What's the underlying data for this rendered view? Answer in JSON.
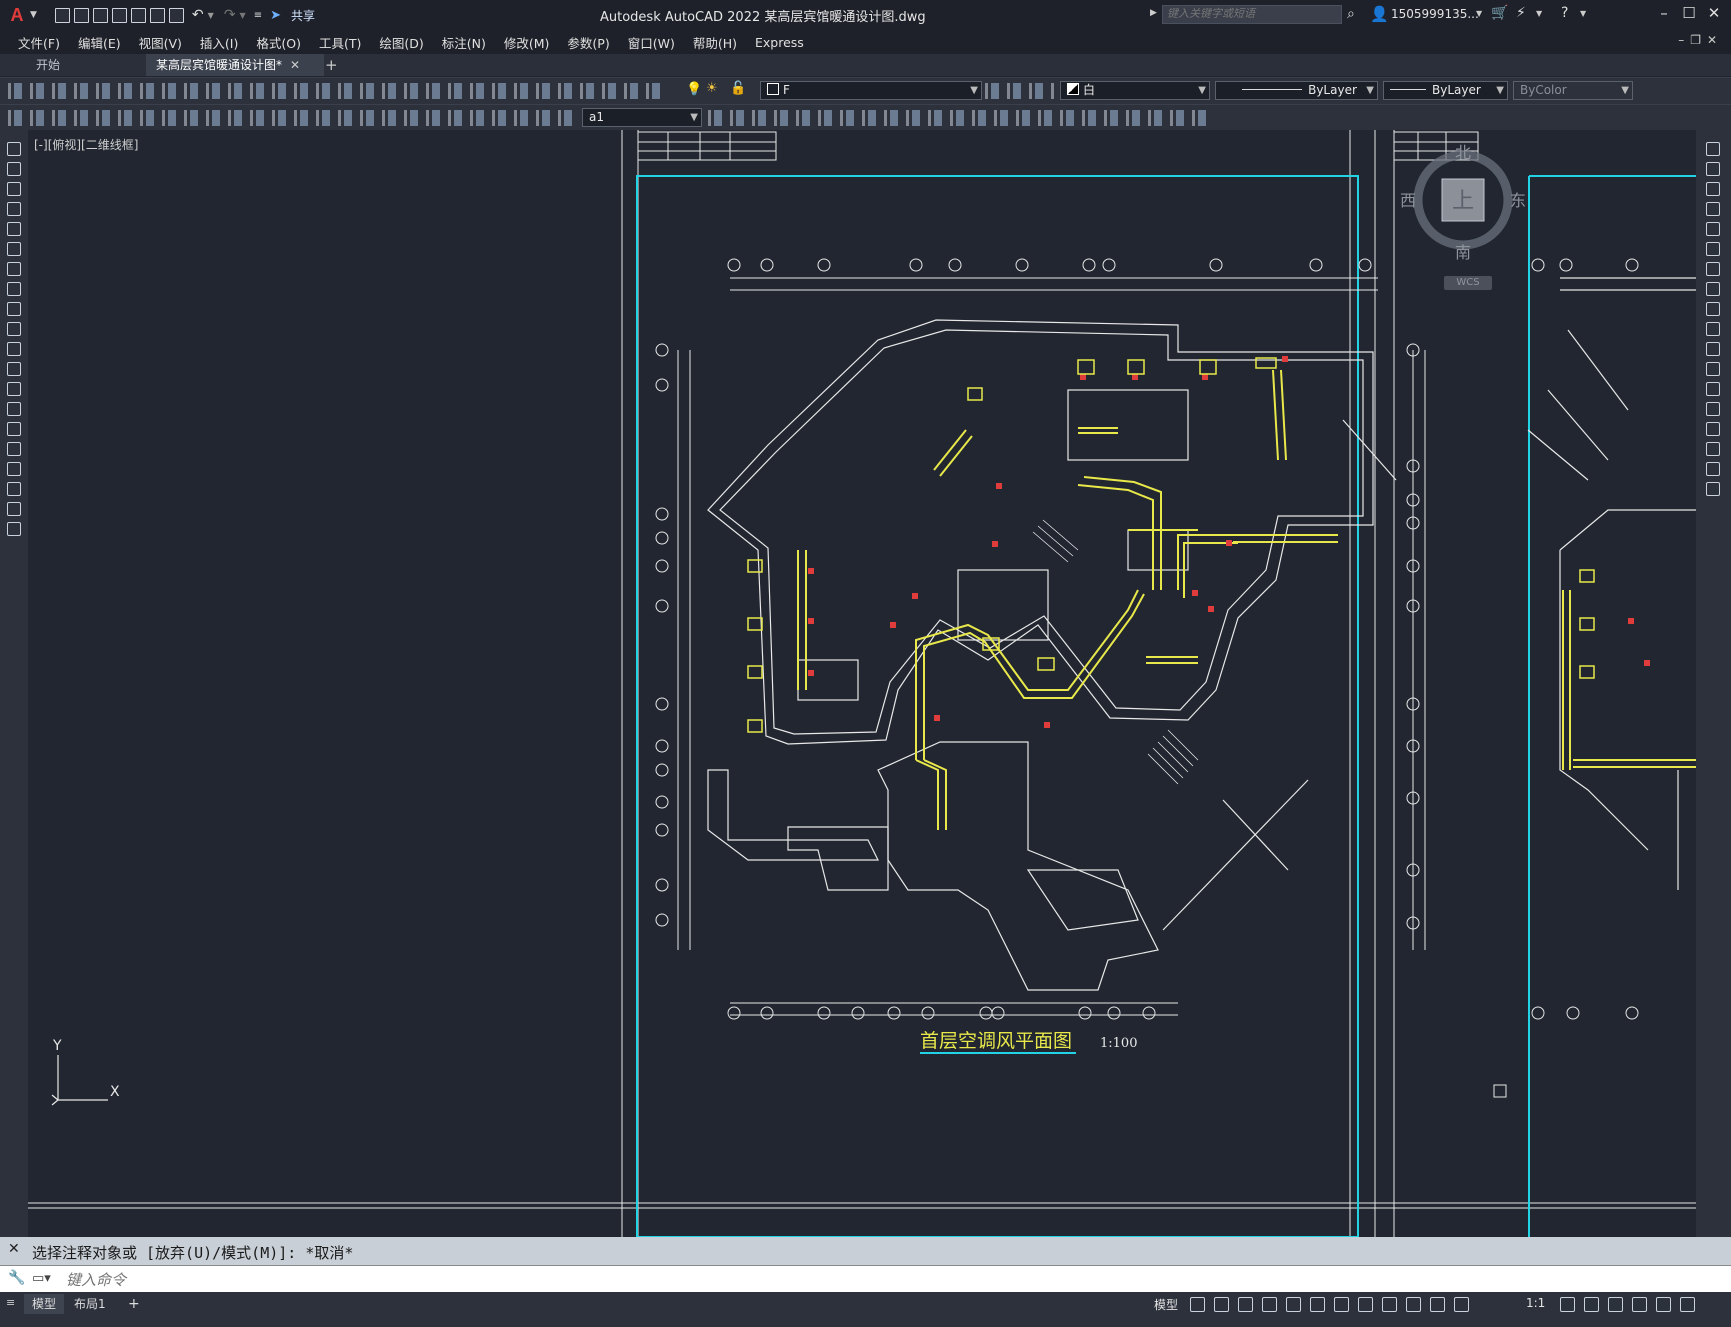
{
  "titlebar": {
    "app_logo": "A",
    "share_label": "共享",
    "title": "Autodesk AutoCAD 2022    某高层宾馆暖通设计图.dwg",
    "search_placeholder": "键入关键字或短语",
    "user_name": "1505999135...",
    "icons": [
      "new-icon",
      "open-icon",
      "save-icon",
      "saveas-icon",
      "plot-icon",
      "undo-icon",
      "redo-icon",
      "share-icon",
      "search-icon",
      "user-icon",
      "cart-icon",
      "autodesk-app-icon",
      "help-icon",
      "minimize-icon",
      "maximize-icon",
      "close-icon"
    ]
  },
  "menubar": {
    "items": [
      "文件(F)",
      "编辑(E)",
      "视图(V)",
      "插入(I)",
      "格式(O)",
      "工具(T)",
      "绘图(D)",
      "标注(N)",
      "修改(M)",
      "参数(P)",
      "窗口(W)",
      "帮助(H)",
      "Express"
    ]
  },
  "tabs": {
    "start": "开始",
    "document": "某高层宾馆暖通设计图*",
    "add": "+"
  },
  "toolbar1": {
    "layer_value": "F",
    "color_value": "白",
    "linetype_value": "ByLayer",
    "lineweight_value": "ByLayer",
    "plotstyle_value": "ByColor"
  },
  "toolbar2": {
    "dimstyle_value": "a1"
  },
  "canvas": {
    "viewport_label": "[-][俯视][二维线框]",
    "drawing_title": "首层空调风平面图",
    "drawing_scale": "1:100",
    "ucs_x": "X",
    "ucs_y": "Y",
    "colors": {
      "background": "#212630",
      "lines": "#e8e8e8",
      "duct": "#e8e84a",
      "border": "#22d3e6",
      "red": "#e03c3c"
    }
  },
  "viewcube": {
    "north": "北",
    "south": "南",
    "east": "东",
    "west": "西",
    "top": "上",
    "wcs": "WCS"
  },
  "command": {
    "history": "选择注释对象或 [放弃(U)/模式(M)]: *取消*",
    "input_placeholder": "键入命令"
  },
  "statusbar": {
    "model_tab": "模型",
    "layout1_tab": "布局1",
    "add_tab": "+",
    "model_label": "模型",
    "scale": "1:1"
  }
}
